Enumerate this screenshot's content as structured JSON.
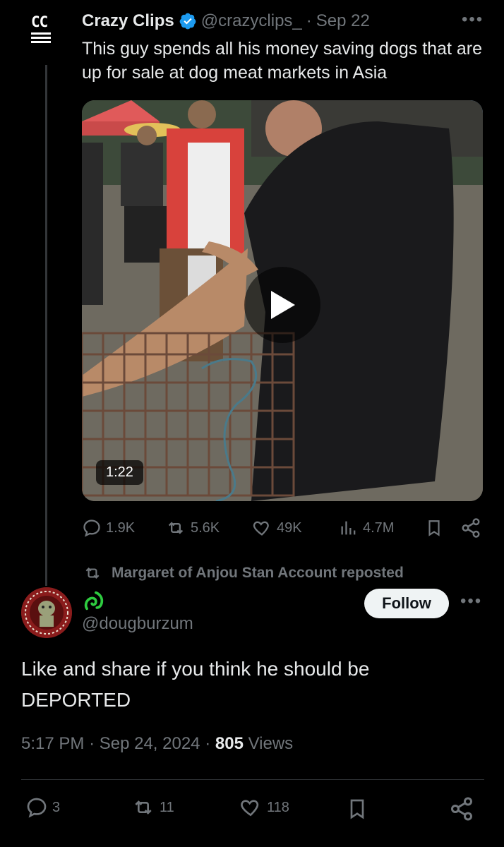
{
  "quoted": {
    "logo_text": "CC",
    "name": "Crazy Clips",
    "handle": "@crazyclips_",
    "dot": "·",
    "date": "Sep 22",
    "text": "This guy spends all his money saving dogs that are up for sale at dog meat markets in Asia",
    "video_duration": "1:22",
    "actions": {
      "replies": "1.9K",
      "reposts": "5.6K",
      "likes": "49K",
      "views": "4.7M"
    }
  },
  "repost_banner": "Margaret of Anjou Stan Account reposted",
  "post": {
    "handle": "@dougburzum",
    "follow_label": "Follow",
    "text_line1": "Like and share if you think he should be",
    "text_line2": "DEPORTED",
    "time": "5:17 PM",
    "date": "Sep 24, 2024",
    "views_count": "805",
    "views_label": "Views",
    "actions": {
      "replies": "3",
      "reposts": "11",
      "likes": "118"
    }
  },
  "colors": {
    "background": "#000000",
    "text_primary": "#e7e9ea",
    "text_secondary": "#71767b",
    "verified": "#1d9bf0",
    "handle_icon": "#2ecc40"
  },
  "icons": [
    "cc-logo",
    "verified-badge-icon",
    "more-icon",
    "play-icon",
    "reply-icon",
    "repost-icon",
    "like-icon",
    "views-icon",
    "bookmark-icon",
    "share-icon",
    "handle-symbol-icon"
  ]
}
